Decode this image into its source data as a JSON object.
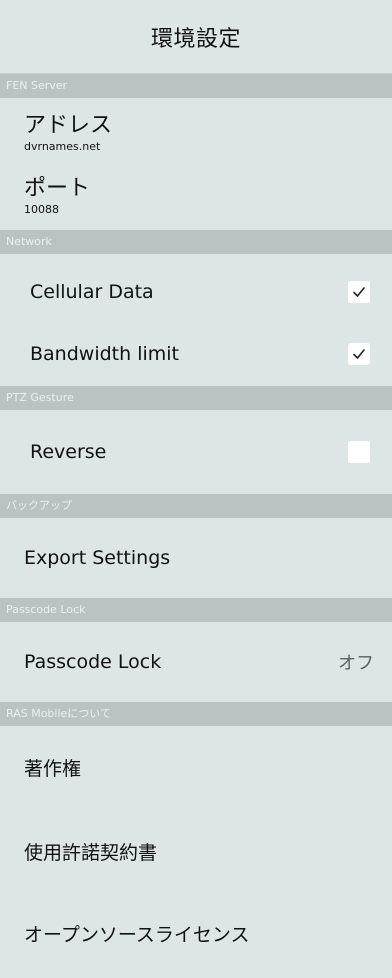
{
  "header": {
    "title": "環境設定"
  },
  "sections": {
    "fen_server": {
      "header": "FEN Server",
      "address_label": "アドレス",
      "address_value": "dvrnames.net",
      "port_label": "ポート",
      "port_value": "10088"
    },
    "network": {
      "header": "Network",
      "cellular_label": "Cellular Data",
      "cellular_checked": true,
      "bandwidth_label": "Bandwidth limit",
      "bandwidth_checked": true
    },
    "ptz": {
      "header": "PTZ Gesture",
      "reverse_label": "Reverse",
      "reverse_checked": false
    },
    "backup": {
      "header": "バックアップ",
      "export_label": "Export Settings"
    },
    "passcode": {
      "header": "Passcode Lock",
      "lock_label": "Passcode Lock",
      "lock_value": "オフ"
    },
    "about": {
      "header": "RAS Mobileについて",
      "copyright_label": "著作権",
      "license_agreement_label": "使用許諾契約書",
      "oss_label": "オープンソースライセンス"
    }
  },
  "icons": {
    "checkmark": "checkmark-icon"
  },
  "colors": {
    "background": "#dde6e7",
    "section_header_bg": "#bac3c4",
    "section_header_text": "#e9f0f0",
    "checkbox_bg": "#ffffff",
    "check_color": "#222222"
  }
}
